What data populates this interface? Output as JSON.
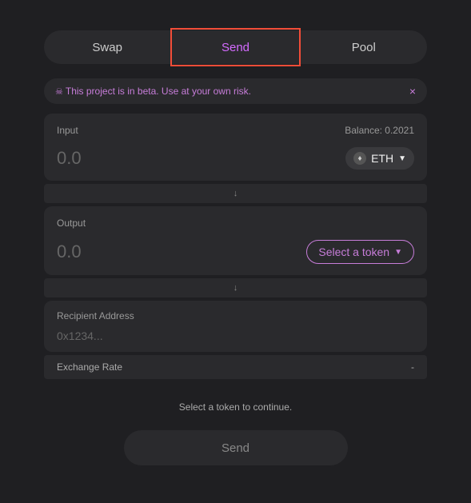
{
  "tabs": {
    "swap": "Swap",
    "send": "Send",
    "pool": "Pool"
  },
  "banner": {
    "skull": "☠",
    "text": "This project is in beta. Use at your own risk.",
    "close": "×"
  },
  "input": {
    "label": "Input",
    "balance_label": "Balance: 0.2021",
    "amount": "0.0",
    "token_symbol": "ETH",
    "eth_glyph": "♦"
  },
  "arrow": "↓",
  "output": {
    "label": "Output",
    "amount": "0.0",
    "select_label": "Select a token"
  },
  "recipient": {
    "label": "Recipient Address",
    "placeholder": "0x1234..."
  },
  "rate": {
    "label": "Exchange Rate",
    "value": "-"
  },
  "hint": "Select a token to continue.",
  "send_button": "Send"
}
